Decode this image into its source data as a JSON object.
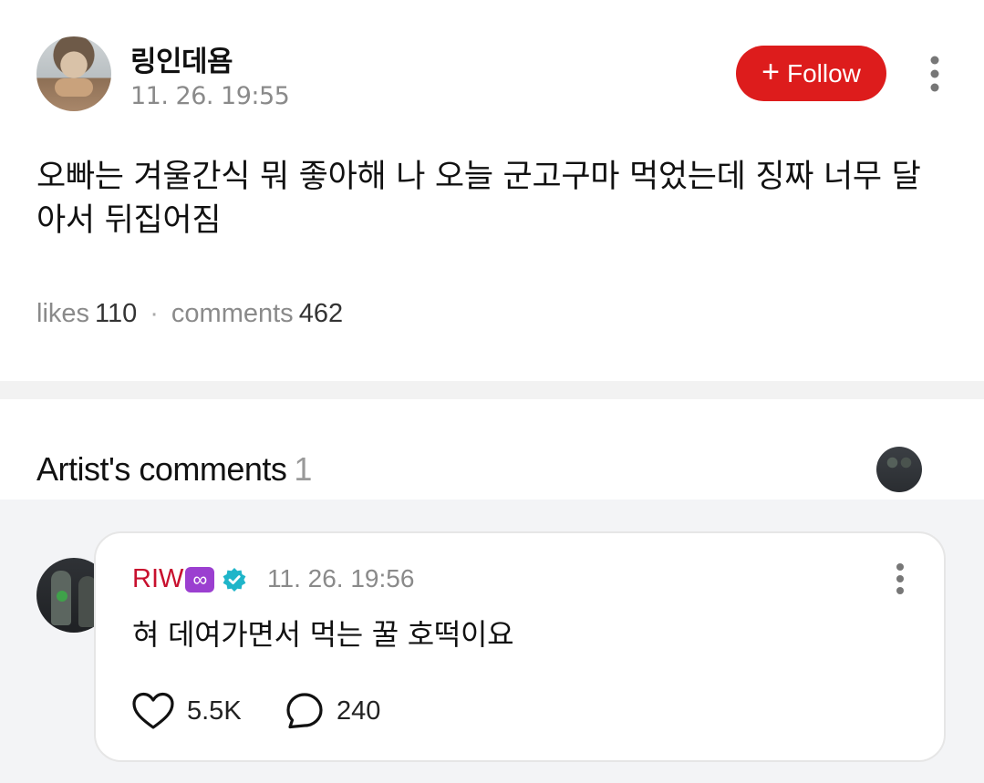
{
  "post": {
    "author": "링인데욤",
    "timestamp": "11. 26. 19:55",
    "follow_label": "Follow",
    "text": "오빠는 겨울간식 뭐 좋아해 나 오늘 군고구마 먹었는데 징짜 너무 달아서 뒤집어짐",
    "likes_label": "likes",
    "likes_count": "110",
    "comments_label": "comments",
    "comments_count": "462"
  },
  "artist_comments": {
    "title": "Artist's comments",
    "count": "1"
  },
  "comment": {
    "author": "RIW",
    "badge": "∞",
    "timestamp": "11. 26. 19:56",
    "text": "혀 데여가면서 먹는 꿀 호떡이요",
    "likes": "5.5K",
    "replies": "240"
  },
  "colors": {
    "follow_button": "#dd1c1c",
    "artist_name": "#c8102e",
    "badge": "#9b3fd0",
    "verified": "#1fb5c9"
  }
}
